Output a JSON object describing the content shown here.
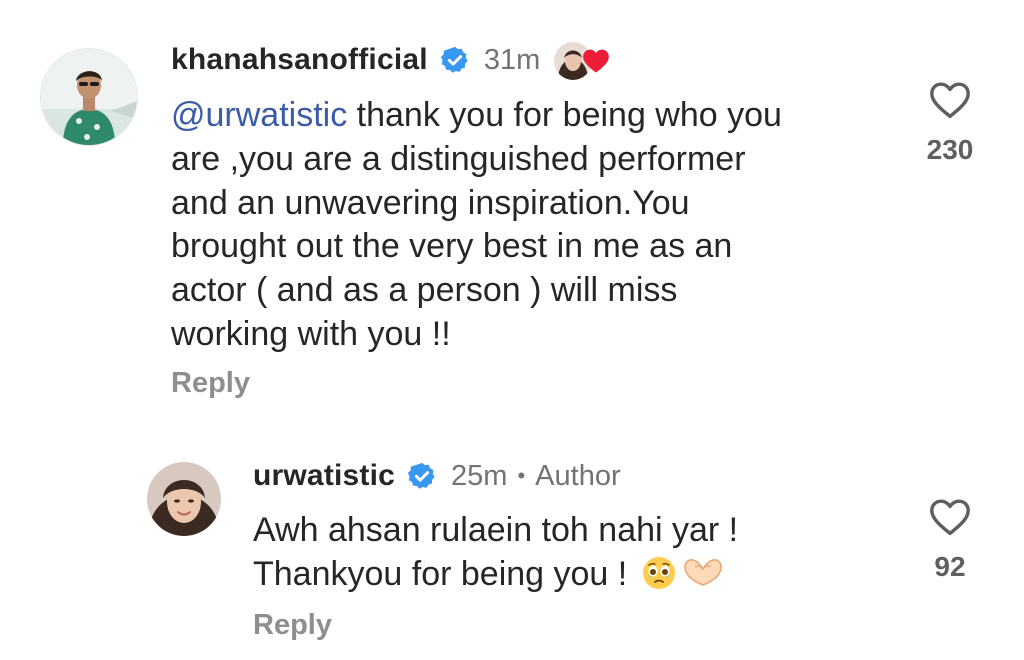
{
  "comments": [
    {
      "username": "khanahsanofficial",
      "time": "31m",
      "mention": "@urwatistic",
      "lines": [
        " thank you for being who you",
        "are ,you are a distinguished performer",
        "and an unwavering inspiration.You",
        "brought out the very best in me as an",
        "actor ( and as a person ) will miss",
        "working with you !!"
      ],
      "reply_label": "Reply",
      "like_count": "230"
    },
    {
      "username": "urwatistic",
      "time": "25m",
      "separator": "•",
      "author_label": "Author",
      "lines": [
        "Awh ahsan rulaein toh nahi yar !",
        "Thankyou for being you ! "
      ],
      "reply_label": "Reply",
      "like_count": "92"
    }
  ],
  "colors": {
    "verified": "#3897f0",
    "mention": "#3b5ba8",
    "liked_heart": "#ed1c38"
  },
  "icons": {
    "verified": "verified-badge-icon",
    "like": "heart-outline-icon",
    "creator_liked": "red-heart-icon",
    "emoji_1": "face-holding-back-tears-emoji",
    "emoji_2": "heart-hands-emoji"
  }
}
